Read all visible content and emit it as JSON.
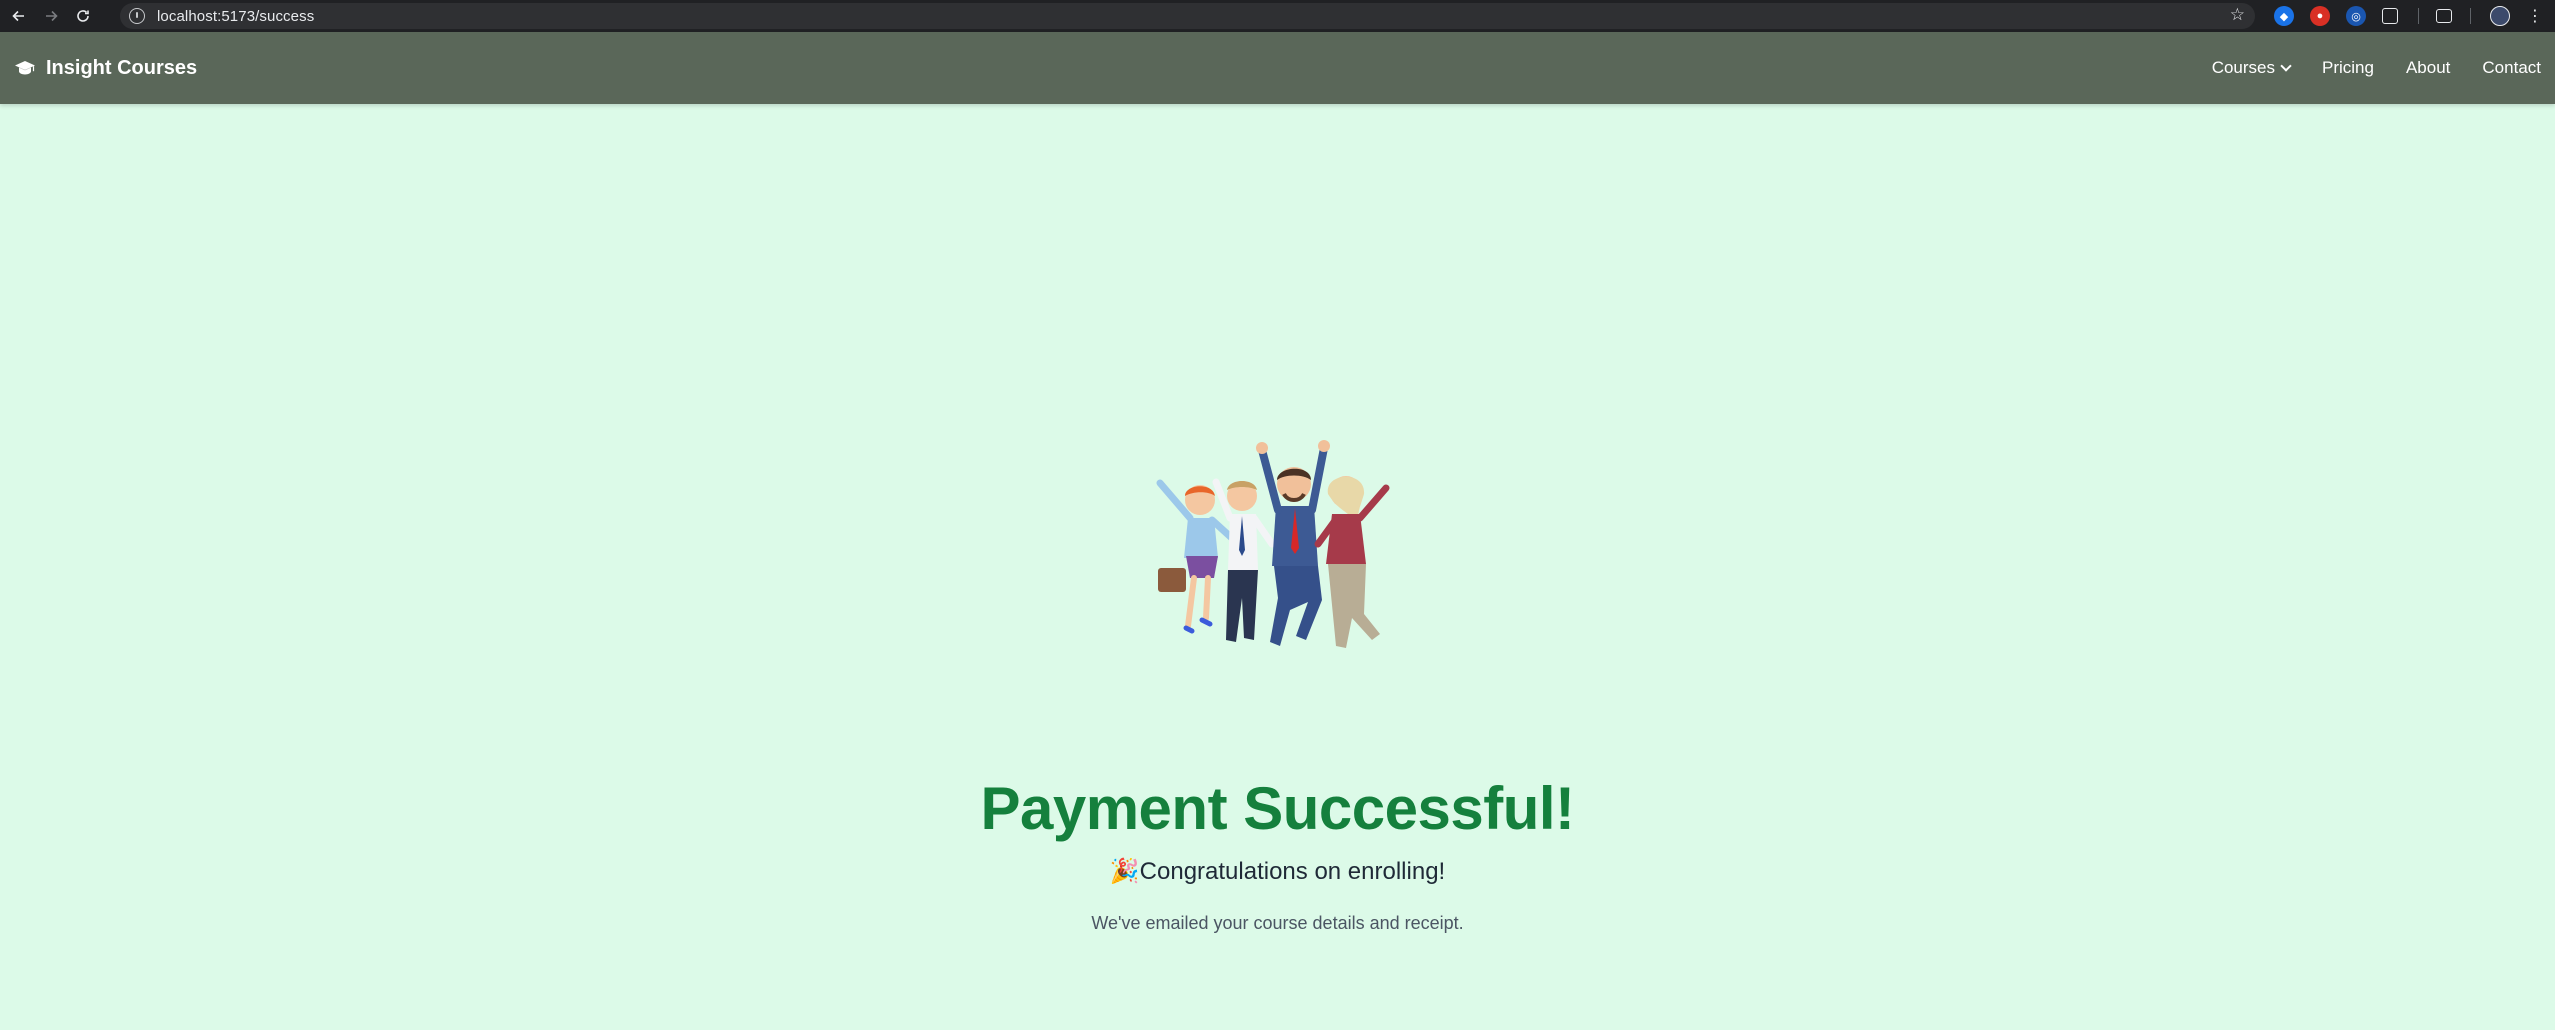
{
  "browser": {
    "url": "localhost:5173/success"
  },
  "site": {
    "brand": "Insight Courses",
    "brand_icon": "graduation-cap-icon",
    "nav": {
      "courses": "Courses",
      "pricing": "Pricing",
      "about": "About",
      "contact": "Contact"
    }
  },
  "main": {
    "illustration": "celebrating-people-illustration",
    "title": "Payment Successful!",
    "subtitle_emoji": "🎉",
    "subtitle": "Congratulations on enrolling!",
    "note": "We've emailed your course details and receipt."
  },
  "colors": {
    "page_bg": "#dcfae8",
    "navbar_bg": "#5a6759",
    "title": "#15803d"
  }
}
